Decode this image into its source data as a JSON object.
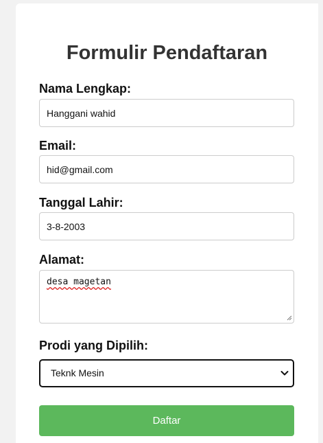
{
  "form": {
    "title": "Formulir Pendaftaran",
    "name_label": "Nama Lengkap:",
    "name_value": "Hanggani wahid",
    "email_label": "Email:",
    "email_value": "hid@gmail.com",
    "dob_label": "Tanggal Lahir:",
    "dob_value": "3-8-2003",
    "address_label": "Alamat:",
    "address_value": "desa magetan",
    "program_label": "Prodi yang Dipilih:",
    "program_selected": "Teknk Mesin",
    "submit_label": "Daftar"
  },
  "colors": {
    "submit_background": "#5cb85c",
    "title_text": "#333333",
    "page_background": "#f2f2f2"
  },
  "icons": {
    "select_arrow": "chevron-down-icon",
    "textarea_resize": "resize-grip-icon"
  }
}
